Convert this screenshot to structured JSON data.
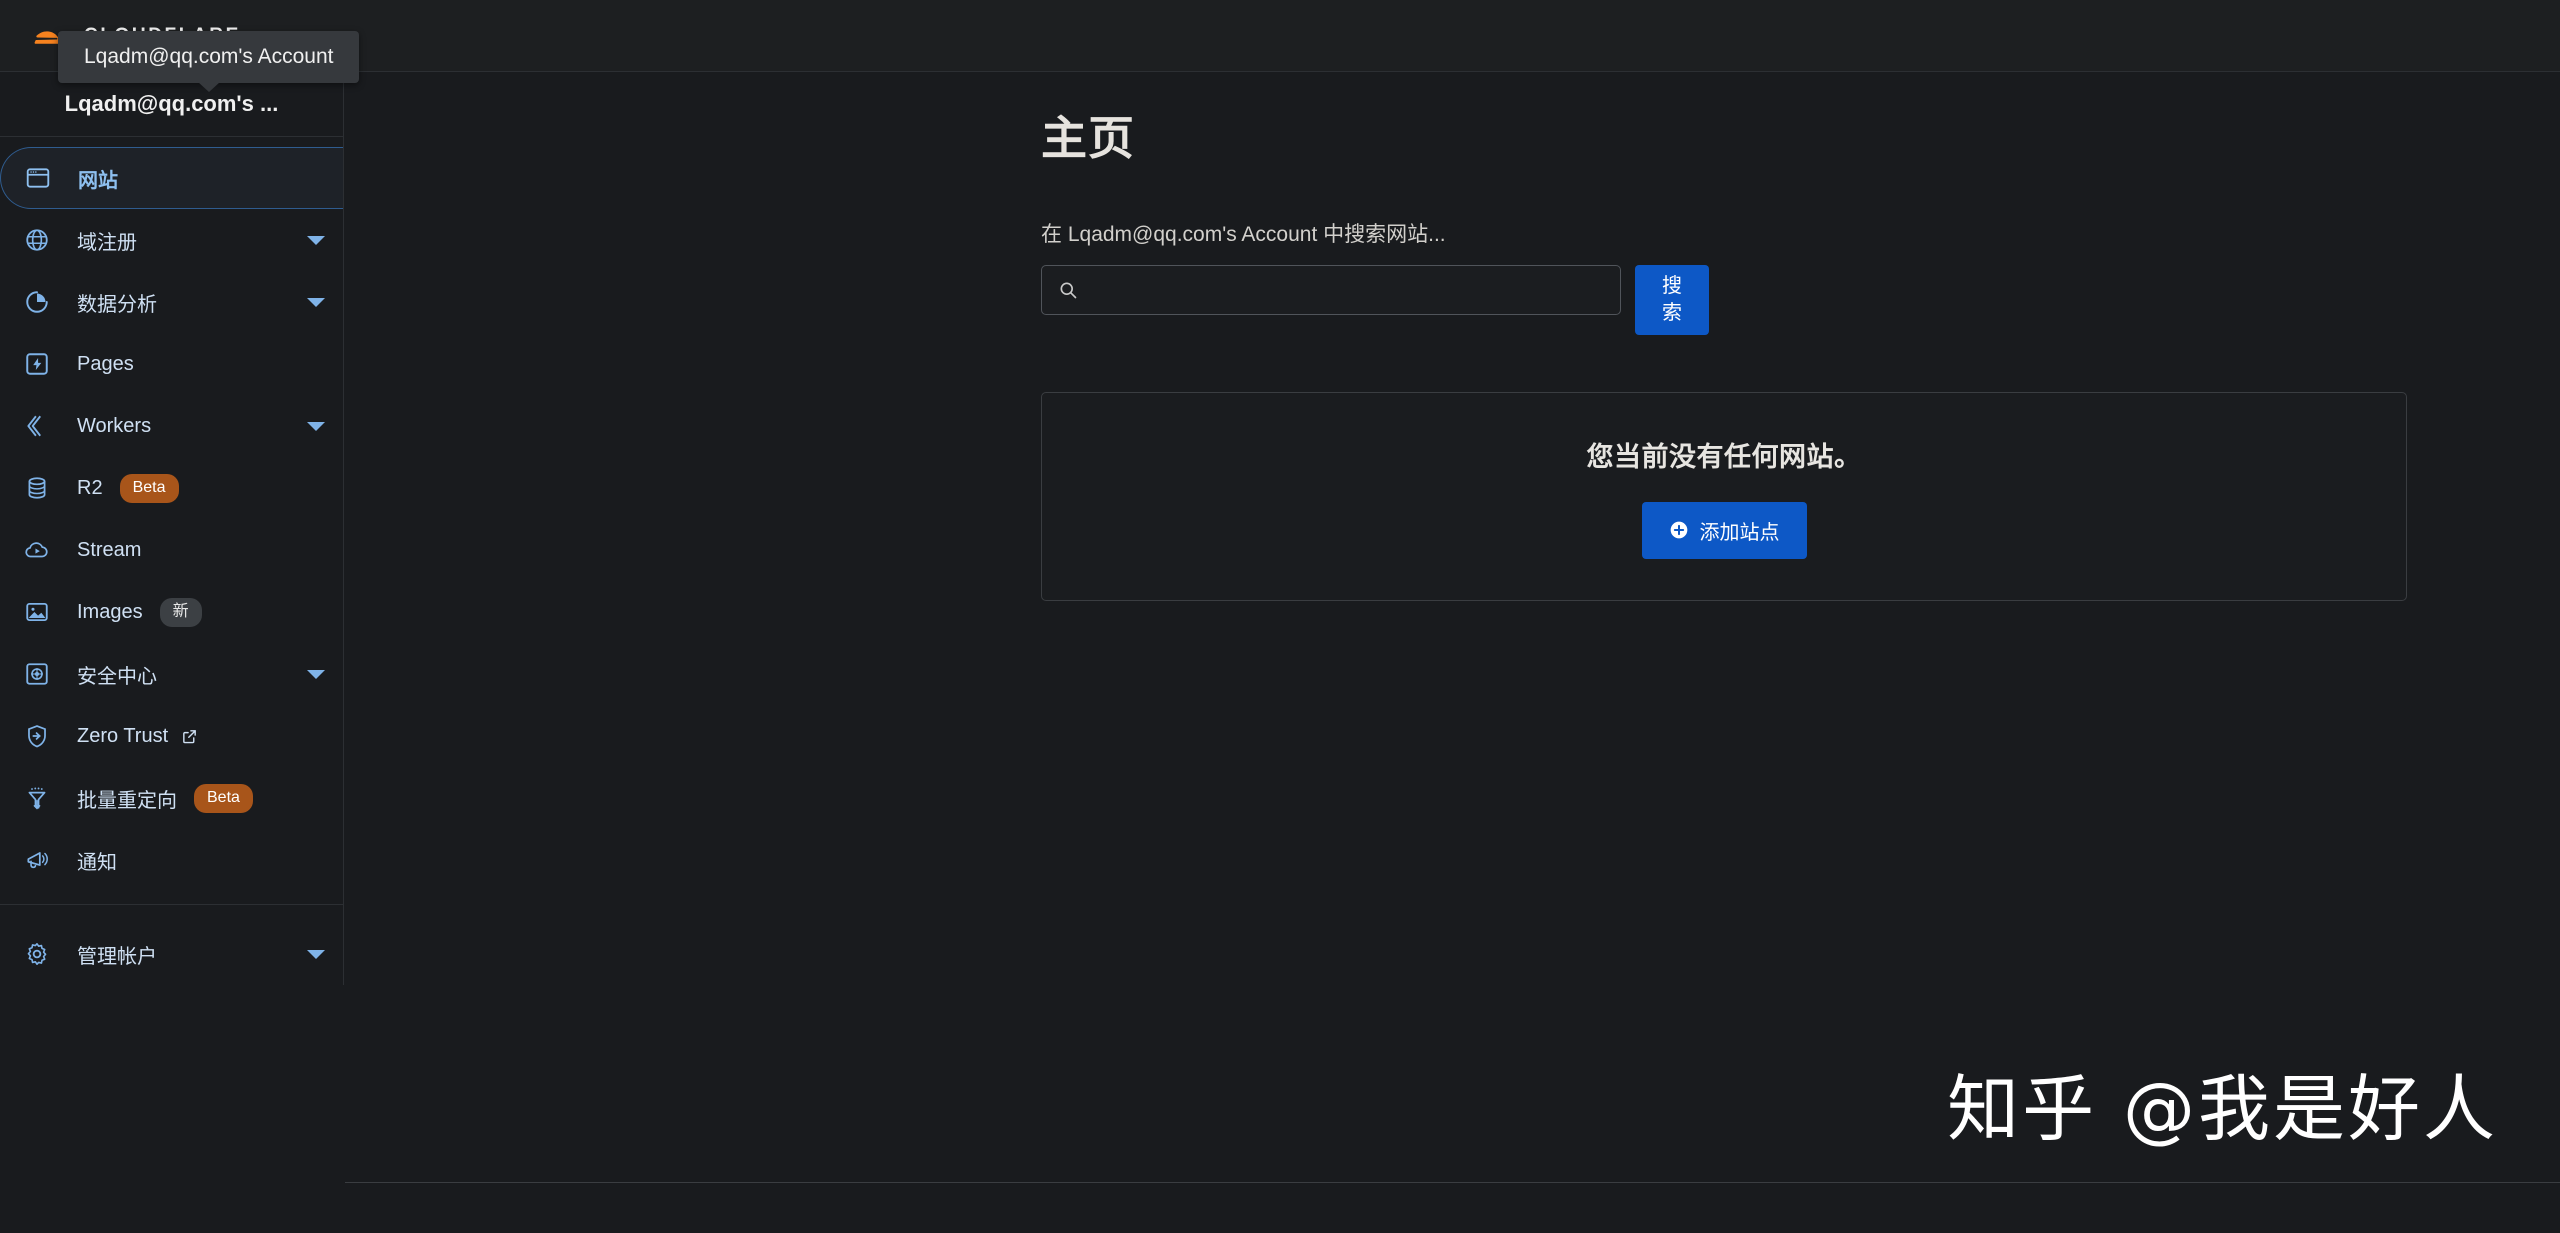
{
  "topbar": {
    "brand_word": "CLOUDFLARE",
    "logo_icon": "cloudflare-cloud-logo"
  },
  "tooltip": {
    "text": "Lqadm@qq.com's Account"
  },
  "sidebar": {
    "account_name": "Lqadm@qq.com's ...",
    "items": [
      {
        "label": "网站",
        "icon": "browser-window-icon",
        "active": true,
        "chevron": false,
        "badge": null,
        "external": false
      },
      {
        "label": "域注册",
        "icon": "globe-icon",
        "active": false,
        "chevron": true,
        "badge": null,
        "external": false
      },
      {
        "label": "数据分析",
        "icon": "pie-chart-icon",
        "active": false,
        "chevron": true,
        "badge": null,
        "external": false
      },
      {
        "label": "Pages",
        "icon": "lightning-page-icon",
        "active": false,
        "chevron": false,
        "badge": null,
        "external": false
      },
      {
        "label": "Workers",
        "icon": "workers-diamond-icon",
        "active": false,
        "chevron": true,
        "badge": null,
        "external": false
      },
      {
        "label": "R2",
        "icon": "database-icon",
        "active": false,
        "chevron": false,
        "badge": "Beta",
        "badge_kind": "beta",
        "external": false
      },
      {
        "label": "Stream",
        "icon": "cloud-play-icon",
        "active": false,
        "chevron": false,
        "badge": null,
        "external": false
      },
      {
        "label": "Images",
        "icon": "image-icon",
        "active": false,
        "chevron": false,
        "badge": "新",
        "badge_kind": "new",
        "external": false
      },
      {
        "label": "安全中心",
        "icon": "shield-target-icon",
        "active": false,
        "chevron": true,
        "badge": null,
        "external": false
      },
      {
        "label": "Zero Trust",
        "icon": "shield-arrow-icon",
        "active": false,
        "chevron": false,
        "badge": null,
        "external": true
      },
      {
        "label": "批量重定向",
        "icon": "funnel-icon",
        "active": false,
        "chevron": false,
        "badge": "Beta",
        "badge_kind": "beta",
        "external": false
      },
      {
        "label": "通知",
        "icon": "megaphone-icon",
        "active": false,
        "chevron": false,
        "badge": null,
        "external": false
      }
    ],
    "footer_items": [
      {
        "label": "管理帐户",
        "icon": "gear-icon",
        "chevron": true
      }
    ]
  },
  "main": {
    "page_title": "主页",
    "search": {
      "label": "在 Lqadm@qq.com's Account 中搜索网站...",
      "value": "",
      "placeholder": "",
      "icon": "search-icon",
      "button_label": "搜索"
    },
    "empty_state": {
      "title": "您当前没有任何网站。",
      "button_label": "添加站点",
      "button_icon": "plus-circle-icon"
    }
  },
  "watermark": {
    "text": "知乎 @我是好人"
  },
  "colors": {
    "page_background": "#191b1e",
    "topbar_background": "#1d1f21",
    "border": "#2c2f33",
    "accent_blue": "#0d58c6",
    "nav_link": "#cfe0f3",
    "nav_active": "#8ec0f0",
    "badge_beta": "#a8551a",
    "badge_new": "#3c4044",
    "logo_orange": "#f38020",
    "tooltip_background": "#36393d"
  }
}
